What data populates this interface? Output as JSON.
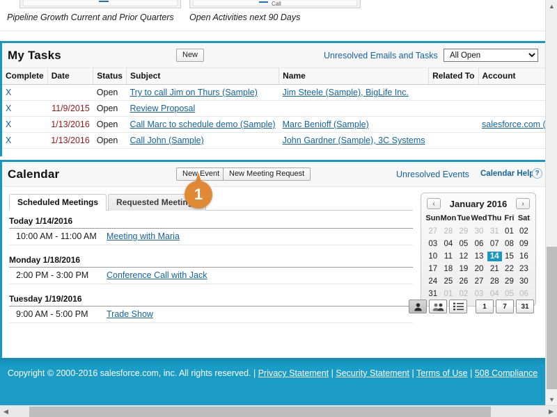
{
  "dashboard": {
    "panels": [
      {
        "caption": "Pipeline Growth Current and Prior Quarters"
      },
      {
        "caption": "Open Activities next 90 Days",
        "chart_label": "Call"
      }
    ]
  },
  "tasks": {
    "title": "My Tasks",
    "new_button": "New",
    "unresolved_link": "Unresolved Emails and Tasks",
    "filter_value": "All Open",
    "columns": [
      "Complete",
      "Date",
      "Status",
      "Subject",
      "Name",
      "Related To",
      "Account"
    ],
    "rows": [
      {
        "complete": "X",
        "date": "",
        "status": "Open",
        "subject": "Try to call Jim on Thurs (Sample)",
        "name": "Jim Steele (Sample), BigLife Inc.",
        "related_to": "",
        "account": ""
      },
      {
        "complete": "X",
        "date": "11/9/2015",
        "status": "Open",
        "subject": "Review Proposal",
        "name": "",
        "related_to": "",
        "account": ""
      },
      {
        "complete": "X",
        "date": "1/13/2016",
        "status": "Open",
        "subject": "Call Marc to schedule demo (Sample)",
        "name": "Marc Benioff (Sample)",
        "related_to": "",
        "account": "salesforce.com (Sample)"
      },
      {
        "complete": "X",
        "date": "1/13/2016",
        "status": "Open",
        "subject": "Call John (Sample)",
        "name": "John Gardner (Sample), 3C Systems",
        "related_to": "",
        "account": ""
      }
    ]
  },
  "calendar": {
    "title": "Calendar",
    "new_event_button": "New Event",
    "new_meeting_button": "New Meeting Request",
    "unresolved_link": "Unresolved Events",
    "help_link": "Calendar Help",
    "help_icon": "?",
    "tabs": [
      {
        "label": "Scheduled Meetings",
        "active": true
      },
      {
        "label": "Requested Meetings",
        "active": false
      }
    ],
    "agenda": [
      {
        "day": "Today 1/14/2016",
        "events": [
          {
            "time": "10:00 AM - 11:00 AM",
            "title": "Meeting with Maria"
          }
        ]
      },
      {
        "day": "Monday 1/18/2016",
        "events": [
          {
            "time": "2:00 PM - 3:00 PM",
            "title": "Conference Call with Jack"
          }
        ]
      },
      {
        "day": "Tuesday 1/19/2016",
        "events": [
          {
            "time": "9:00 AM - 5:00 PM",
            "title": "Trade Show"
          }
        ]
      }
    ],
    "minical": {
      "month_label": "January 2016",
      "prev_icon": "‹",
      "next_icon": "›",
      "weekdays": [
        "Sun",
        "Mon",
        "Tue",
        "Wed",
        "Thu",
        "Fri",
        "Sat"
      ],
      "today": "14",
      "weeks": [
        [
          {
            "d": "27",
            "mute": true
          },
          {
            "d": "28",
            "mute": true
          },
          {
            "d": "29",
            "mute": true
          },
          {
            "d": "30",
            "mute": true
          },
          {
            "d": "31",
            "mute": true
          },
          {
            "d": "01",
            "mute": false
          },
          {
            "d": "02",
            "mute": false
          }
        ],
        [
          {
            "d": "03",
            "mute": false
          },
          {
            "d": "04",
            "mute": false
          },
          {
            "d": "05",
            "mute": false
          },
          {
            "d": "06",
            "mute": false
          },
          {
            "d": "07",
            "mute": false
          },
          {
            "d": "08",
            "mute": false
          },
          {
            "d": "09",
            "mute": false
          }
        ],
        [
          {
            "d": "10",
            "mute": false
          },
          {
            "d": "11",
            "mute": false
          },
          {
            "d": "12",
            "mute": false
          },
          {
            "d": "13",
            "mute": false
          },
          {
            "d": "14",
            "mute": false,
            "today": true
          },
          {
            "d": "15",
            "mute": false
          },
          {
            "d": "16",
            "mute": false
          }
        ],
        [
          {
            "d": "17",
            "mute": false
          },
          {
            "d": "18",
            "mute": false
          },
          {
            "d": "19",
            "mute": false
          },
          {
            "d": "20",
            "mute": false
          },
          {
            "d": "21",
            "mute": false
          },
          {
            "d": "22",
            "mute": false
          },
          {
            "d": "23",
            "mute": false
          }
        ],
        [
          {
            "d": "24",
            "mute": false
          },
          {
            "d": "25",
            "mute": false
          },
          {
            "d": "26",
            "mute": false
          },
          {
            "d": "27",
            "mute": false
          },
          {
            "d": "28",
            "mute": false
          },
          {
            "d": "29",
            "mute": false
          },
          {
            "d": "30",
            "mute": false
          }
        ],
        [
          {
            "d": "31",
            "mute": false
          },
          {
            "d": "01",
            "mute": true
          },
          {
            "d": "02",
            "mute": true
          },
          {
            "d": "03",
            "mute": true
          },
          {
            "d": "04",
            "mute": true
          },
          {
            "d": "05",
            "mute": true
          },
          {
            "d": "06",
            "mute": true
          }
        ]
      ]
    },
    "view_buttons": [
      {
        "name": "single-user-view",
        "label": "",
        "icon": "user",
        "active": true
      },
      {
        "name": "multi-user-view",
        "label": "",
        "icon": "users",
        "active": false
      },
      {
        "name": "list-view",
        "label": "",
        "icon": "list",
        "active": false
      },
      {
        "name": "day-view",
        "label": "1",
        "icon": "text",
        "active": false
      },
      {
        "name": "week-view",
        "label": "7",
        "icon": "text",
        "active": false
      },
      {
        "name": "month-view",
        "label": "31",
        "icon": "text",
        "active": false
      }
    ]
  },
  "annotation": {
    "number": "1"
  },
  "footer": {
    "copyright": "Copyright © 2000-2016 salesforce.com, inc. All rights reserved. |",
    "links": [
      "Privacy Statement",
      "Security Statement",
      "Terms of Use",
      "508 Compliance"
    ],
    "separator": "|"
  },
  "colors": {
    "accent": "#1798c1",
    "link": "#1264a3",
    "date_red": "#9a1616",
    "marker_orange": "#e08a36"
  }
}
